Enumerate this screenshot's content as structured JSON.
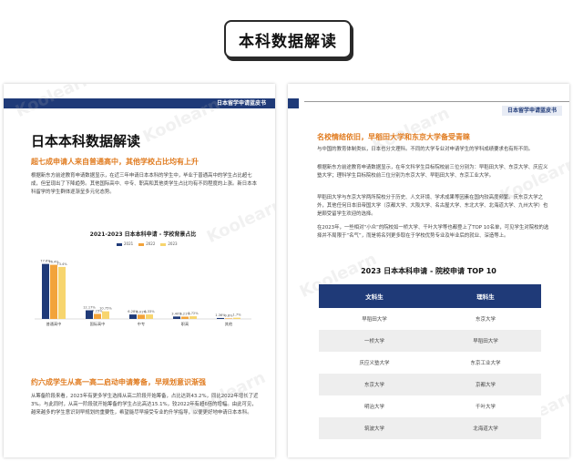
{
  "badge": {
    "title": "本科数据解读"
  },
  "left_page": {
    "header": "日本留学申请蓝皮书",
    "main_title": "日本本科数据解读",
    "section1_title": "超七成申请人来自普通高中，其他学校占比均有上升",
    "section1_para": "根据新东方前途教育申请数据显示，在近三年申请日本本科的学生中，毕业于普通高中的学生占比超七成，但呈现出了下降趋势。其他国际高中、中专、职高和其他类学生占比均有不同程度的上涨。新日本本科留学的学生群体逐渐呈多元化态势。",
    "section2_title": "约六成学生从高一高二启动申请筹备，早规划意识渐强",
    "section2_para": "从筹备阶段来看，2023年有更多学生选择从高二阶段开始筹备，占比达到43.2%，同比2022年增长了近3%。与此同时，从高一阶段就开始筹备的学生占比高达15.1%，较2022年有超6倍的增幅。由此可见，越来越多的学生意识到早规划的重要性，希望能尽早接受专业的升学指导，以便更好地申请日本本科。"
  },
  "chart_data": {
    "type": "bar",
    "title": "2021-2023 日本本科申请 - 学校背景占比",
    "categories": [
      "普通高中",
      "国际高中",
      "中专",
      "职高",
      "其他"
    ],
    "series": [
      {
        "name": "2021",
        "values": [
          77.6,
          12.17,
          6.28,
          3.4,
          1.36
        ]
      },
      {
        "name": "2022",
        "values": [
          76.4,
          7.15,
          6.01,
          3.21,
          0.8
        ]
      },
      {
        "name": "2023",
        "values": [
          73.4,
          10.75,
          6.33,
          3.72,
          1.7
        ]
      }
    ],
    "data_labels": [
      [
        "77.6%",
        "76.4%",
        "73.4%"
      ],
      [
        "12.17%",
        "7.15%",
        "10.75%"
      ],
      [
        "6.28%",
        "6.01%",
        "6.33%"
      ],
      [
        "3.40%",
        "3.21%",
        "3.72%"
      ],
      [
        "1.36%",
        "0.8%",
        "1.7%"
      ]
    ],
    "ylim": [
      0,
      90
    ],
    "colors": [
      "#1f3a78",
      "#f2a33a",
      "#f7d56e"
    ],
    "legend": "top-center",
    "grid": false
  },
  "right_page": {
    "header": "日本留学申请蓝皮书",
    "section_title": "名校情结依旧，早稻田大学和东京大学备受青睐",
    "para1": "与中国的教育体制类似，日本也分文理科。不同的大学专业对申请学生的学科成绩要求也有所不同。",
    "para2": "根据新东方前途教育申请数据显示，在年文科学生目标院校前三位分别为：早稻田大学、东京大学、庆应义塾大学；理科学生目标院校前三位分别为东京大学、早稻田大学、东京工业大学。",
    "para3": "早稻田大学与东京大学两所院校分于历史、人文环境、学术成果等因素在国内较高度频繁。庆东京大学之外，其他任何日本旧帝国大学（京都大学、大阪大学、名古屋大学、东北大学、北海道大学、九州大学）也是颇受留学生欢迎的选择。",
    "para4": "在2023年，一些相对“小众”的院校如一桥大学、千叶大学等也都登上了TOP 10名单，可见学生对院校的选择并不局限于“名气”，而是将名列更多取在于学校优势专业及毕业后的就业、深造等上。",
    "table_title": "2023 日本本科申请 - 院校申请 TOP 10",
    "table_headers": [
      "文科生",
      "理科生"
    ],
    "table_rows": [
      [
        "早稻田大学",
        "东京大学"
      ],
      [
        "一桥大学",
        "早稻田大学"
      ],
      [
        "庆应义塾大学",
        "东京工业大学"
      ],
      [
        "东京大学",
        "京都大学"
      ],
      [
        "明治大学",
        "千叶大学"
      ],
      [
        "筑波大学",
        "北海道大学"
      ]
    ]
  }
}
